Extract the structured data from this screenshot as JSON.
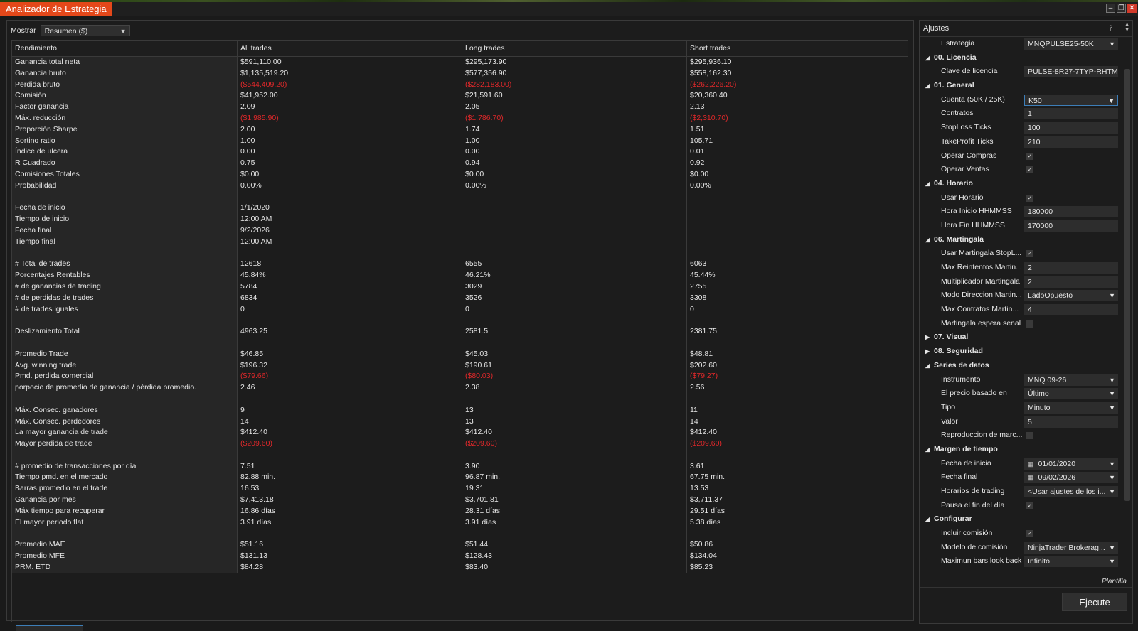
{
  "window": {
    "title": "Analizador de Estrategia"
  },
  "toolbar": {
    "mostrar_label": "Mostrar",
    "mostrar_value": "Resumen ($)"
  },
  "table": {
    "headers": [
      "Rendimiento",
      "All trades",
      "Long trades",
      "Short trades"
    ],
    "rows": [
      {
        "label": "Ganancia total neta",
        "all": "$591,110.00",
        "long": "$295,173.90",
        "short": "$295,936.10"
      },
      {
        "label": "Ganancia bruto",
        "all": "$1,135,519.20",
        "long": "$577,356.90",
        "short": "$558,162.30"
      },
      {
        "label": "Perdida bruto",
        "all": "($544,409.20)",
        "long": "($282,183.00)",
        "short": "($262,226.20)",
        "neg": true
      },
      {
        "label": "Comisión",
        "all": "$41,952.00",
        "long": "$21,591.60",
        "short": "$20,360.40"
      },
      {
        "label": "Factor ganancia",
        "all": "2.09",
        "long": "2.05",
        "short": "2.13"
      },
      {
        "label": "Máx. reducción",
        "all": "($1,985.90)",
        "long": "($1,786.70)",
        "short": "($2,310.70)",
        "neg": true
      },
      {
        "label": "Proporción Sharpe",
        "all": "2.00",
        "long": "1.74",
        "short": "1.51"
      },
      {
        "label": "Sortino ratio",
        "all": "1.00",
        "long": "1.00",
        "short": "105.71"
      },
      {
        "label": "Índice de ulcera",
        "all": "0.00",
        "long": "0.00",
        "short": "0.01"
      },
      {
        "label": "R Cuadrado",
        "all": "0.75",
        "long": "0.94",
        "short": "0.92"
      },
      {
        "label": "Comisiones Totales",
        "all": "$0.00",
        "long": "$0.00",
        "short": "$0.00"
      },
      {
        "label": "Probabilidad",
        "all": "0.00%",
        "long": "0.00%",
        "short": "0.00%"
      },
      {
        "label": "",
        "all": "",
        "long": "",
        "short": ""
      },
      {
        "label": "Fecha de inicio",
        "all": "1/1/2020",
        "long": "",
        "short": ""
      },
      {
        "label": "Tiempo de inicio",
        "all": "12:00 AM",
        "long": "",
        "short": ""
      },
      {
        "label": "Fecha final",
        "all": "9/2/2026",
        "long": "",
        "short": ""
      },
      {
        "label": "Tiempo final",
        "all": "12:00 AM",
        "long": "",
        "short": ""
      },
      {
        "label": "",
        "all": "",
        "long": "",
        "short": ""
      },
      {
        "label": "# Total de trades",
        "all": "12618",
        "long": "6555",
        "short": "6063"
      },
      {
        "label": "Porcentajes Rentables",
        "all": "45.84%",
        "long": "46.21%",
        "short": "45.44%"
      },
      {
        "label": "# de ganancias de trading",
        "all": "5784",
        "long": "3029",
        "short": "2755"
      },
      {
        "label": "# de perdidas de trades",
        "all": "6834",
        "long": "3526",
        "short": "3308"
      },
      {
        "label": "# de trades iguales",
        "all": "0",
        "long": "0",
        "short": "0"
      },
      {
        "label": "",
        "all": "",
        "long": "",
        "short": ""
      },
      {
        "label": "Deslizamiento Total",
        "all": "4963.25",
        "long": "2581.5",
        "short": "2381.75"
      },
      {
        "label": "",
        "all": "",
        "long": "",
        "short": ""
      },
      {
        "label": "Promedio Trade",
        "all": "$46.85",
        "long": "$45.03",
        "short": "$48.81"
      },
      {
        "label": "Avg. winning trade",
        "all": "$196.32",
        "long": "$190.61",
        "short": "$202.60"
      },
      {
        "label": "Pmd. perdida comercial",
        "all": "($79.66)",
        "long": "($80.03)",
        "short": "($79.27)",
        "neg": true
      },
      {
        "label": "porpocio de promedio de ganancia / pérdida promedio.",
        "all": "2.46",
        "long": "2.38",
        "short": "2.56"
      },
      {
        "label": "",
        "all": "",
        "long": "",
        "short": ""
      },
      {
        "label": "Máx. Consec. ganadores",
        "all": "9",
        "long": "13",
        "short": "11"
      },
      {
        "label": "Máx. Consec. perdedores",
        "all": "14",
        "long": "13",
        "short": "14"
      },
      {
        "label": "La mayor ganancia de trade",
        "all": "$412.40",
        "long": "$412.40",
        "short": "$412.40"
      },
      {
        "label": "Mayor perdida de trade",
        "all": "($209.60)",
        "long": "($209.60)",
        "short": "($209.60)",
        "neg": true
      },
      {
        "label": "",
        "all": "",
        "long": "",
        "short": ""
      },
      {
        "label": "# promedio de transacciones por día",
        "all": "7.51",
        "long": "3.90",
        "short": "3.61"
      },
      {
        "label": "Tiempo pmd. en el mercado",
        "all": "82.88 min.",
        "long": "96.87 min.",
        "short": "67.75 min."
      },
      {
        "label": "Barras promedio en el trade",
        "all": "16.53",
        "long": "19.31",
        "short": "13.53"
      },
      {
        "label": "Ganancia por mes",
        "all": "$7,413.18",
        "long": "$3,701.81",
        "short": "$3,711.37"
      },
      {
        "label": "Máx tiempo para recuperar",
        "all": "16.86 días",
        "long": "28.31 días",
        "short": "29.51 días"
      },
      {
        "label": "El mayor periodo flat",
        "all": "3.91 días",
        "long": "3.91 días",
        "short": "5.38 días"
      },
      {
        "label": "",
        "all": "",
        "long": "",
        "short": ""
      },
      {
        "label": "Promedio MAE",
        "all": "$51.16",
        "long": "$51.44",
        "short": "$50.86"
      },
      {
        "label": "Promedio MFE",
        "all": "$131.13",
        "long": "$128.43",
        "short": "$134.04"
      },
      {
        "label": "PRM. ETD",
        "all": "$84.28",
        "long": "$83.40",
        "short": "$85.23"
      }
    ]
  },
  "settings": {
    "title": "Ajustes",
    "items": [
      {
        "kind": "prop",
        "label": "Estrategia",
        "value": "MNQPULSE25-50K",
        "type": "select"
      },
      {
        "kind": "cat",
        "label": "00. Licencia",
        "open": true
      },
      {
        "kind": "prop",
        "label": "Clave de licencia",
        "value": "PULSE-8R27-7TYP-RHTM",
        "type": "text"
      },
      {
        "kind": "cat",
        "label": "01. General",
        "open": true
      },
      {
        "kind": "prop",
        "label": "Cuenta (50K / 25K)",
        "value": "K50",
        "type": "select",
        "active": true
      },
      {
        "kind": "prop",
        "label": "Contratos",
        "value": "1",
        "type": "text"
      },
      {
        "kind": "prop",
        "label": "StopLoss Ticks",
        "value": "100",
        "type": "text"
      },
      {
        "kind": "prop",
        "label": "TakeProfit Ticks",
        "value": "210",
        "type": "text"
      },
      {
        "kind": "prop",
        "label": "Operar Compras",
        "type": "check",
        "checked": true
      },
      {
        "kind": "prop",
        "label": "Operar Ventas",
        "type": "check",
        "checked": true
      },
      {
        "kind": "cat",
        "label": "04. Horario",
        "open": true
      },
      {
        "kind": "prop",
        "label": "Usar Horario",
        "type": "check",
        "checked": true
      },
      {
        "kind": "prop",
        "label": "Hora Inicio HHMMSS",
        "value": "180000",
        "type": "text"
      },
      {
        "kind": "prop",
        "label": "Hora Fin HHMMSS",
        "value": "170000",
        "type": "text"
      },
      {
        "kind": "cat",
        "label": "06. Martingala",
        "open": true
      },
      {
        "kind": "prop",
        "label": "Usar Martingala StopL...",
        "type": "check",
        "checked": true
      },
      {
        "kind": "prop",
        "label": "Max Reintentos Martin...",
        "value": "2",
        "type": "text"
      },
      {
        "kind": "prop",
        "label": "Multiplicador Martingala",
        "value": "2",
        "type": "text"
      },
      {
        "kind": "prop",
        "label": "Modo Direccion Martin...",
        "value": "LadoOpuesto",
        "type": "select"
      },
      {
        "kind": "prop",
        "label": "Max Contratos Martin...",
        "value": "4",
        "type": "text"
      },
      {
        "kind": "prop",
        "label": "Martingala espera senal",
        "type": "check",
        "checked": false
      },
      {
        "kind": "cat",
        "label": "07. Visual",
        "open": false
      },
      {
        "kind": "cat",
        "label": "08. Seguridad",
        "open": false
      },
      {
        "kind": "cat",
        "label": "Series de datos",
        "open": true
      },
      {
        "kind": "prop",
        "label": "Instrumento",
        "value": "MNQ 09-26",
        "type": "select"
      },
      {
        "kind": "prop",
        "label": "El precio basado en",
        "value": "Último",
        "type": "select"
      },
      {
        "kind": "prop",
        "label": "Tipo",
        "value": "Minuto",
        "type": "select"
      },
      {
        "kind": "prop",
        "label": "Valor",
        "value": "5",
        "type": "text"
      },
      {
        "kind": "prop",
        "label": "Reproduccion de marc...",
        "type": "check",
        "checked": false
      },
      {
        "kind": "cat",
        "label": "Margen de tiempo",
        "open": true
      },
      {
        "kind": "prop",
        "label": "Fecha de inicio",
        "value": "01/01/2020",
        "type": "date"
      },
      {
        "kind": "prop",
        "label": "Fecha final",
        "value": "09/02/2026",
        "type": "date"
      },
      {
        "kind": "prop",
        "label": "Horarios de trading",
        "value": "<Usar ajustes de los i...",
        "type": "select"
      },
      {
        "kind": "prop",
        "label": "Pausa el fin del día",
        "type": "check",
        "checked": true
      },
      {
        "kind": "cat",
        "label": "Configurar",
        "open": true
      },
      {
        "kind": "prop",
        "label": "Incluir comisión",
        "type": "check",
        "checked": true
      },
      {
        "kind": "prop",
        "label": "Modelo de comisión",
        "value": "NinjaTrader Brokerag...",
        "type": "select"
      },
      {
        "kind": "prop",
        "label": "Maximun bars look back",
        "value": "Infinito",
        "type": "select"
      }
    ],
    "plantilla": "Plantilla",
    "ejecute": "Ejecute"
  },
  "colors": {
    "accent": "#e4481a",
    "negative": "#e0282a",
    "focus": "#3d7eb8"
  }
}
